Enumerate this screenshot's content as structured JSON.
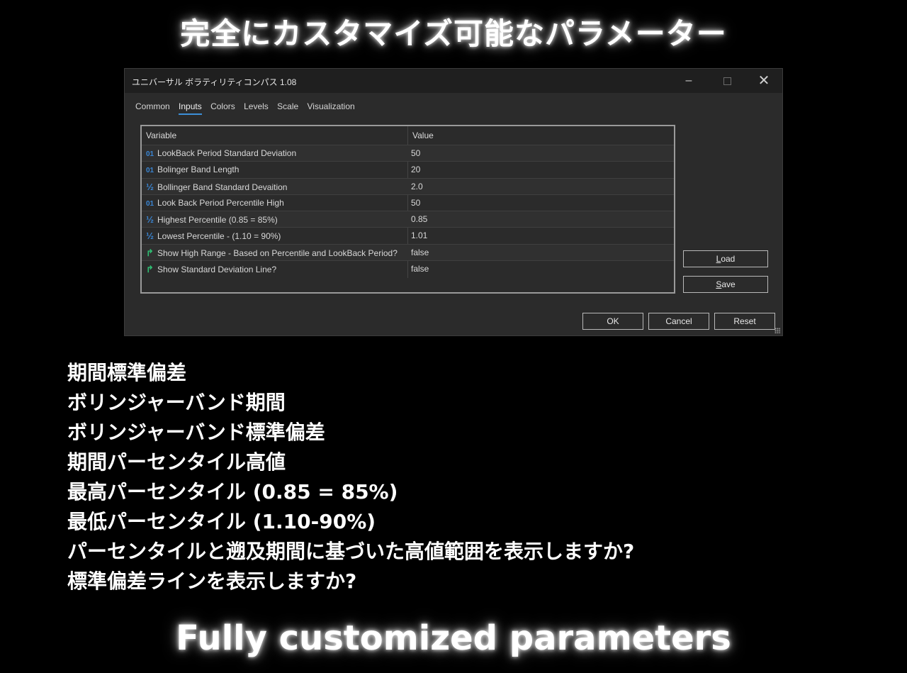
{
  "hero_title": "完全にカスタマイズ可能なパラメーター",
  "footer_title": "Fully customized parameters",
  "window": {
    "title": "ユニバーサル ボラティリティコンパス 1.08",
    "minimize": "–",
    "close": "✕"
  },
  "tabs": [
    {
      "label": "Common"
    },
    {
      "label": "Inputs",
      "active": true
    },
    {
      "label": "Colors"
    },
    {
      "label": "Levels"
    },
    {
      "label": "Scale"
    },
    {
      "label": "Visualization"
    }
  ],
  "grid": {
    "headers": {
      "variable": "Variable",
      "value": "Value"
    },
    "rows": [
      {
        "icon": "integer-icon",
        "glyph": "01",
        "name": "LookBack Period Standard Deviation",
        "value": "50"
      },
      {
        "icon": "integer-icon",
        "glyph": "01",
        "name": "Bolinger Band Length",
        "value": "20"
      },
      {
        "icon": "double-icon",
        "glyph": "½",
        "name": "Bollinger Band Standard Devaition",
        "value": "2.0"
      },
      {
        "icon": "integer-icon",
        "glyph": "01",
        "name": "Look Back Period Percentile High",
        "value": "50"
      },
      {
        "icon": "double-icon",
        "glyph": "½",
        "name": "Highest Percentile (0.85 = 85%)",
        "value": "0.85"
      },
      {
        "icon": "double-icon",
        "glyph": "½",
        "name": "Lowest Percentile - (1.10 = 90%)",
        "value": "1.01"
      },
      {
        "icon": "boolean-icon",
        "glyph": "↱",
        "name": "Show High Range - Based on Percentile and LookBack Period?",
        "value": "false"
      },
      {
        "icon": "boolean-icon",
        "glyph": "↱",
        "name": "Show Standard Deviation Line?",
        "value": "false"
      }
    ]
  },
  "buttons": {
    "load": {
      "mnemonic": "L",
      "rest": "oad"
    },
    "save": {
      "mnemonic": "S",
      "rest": "ave"
    },
    "ok": "OK",
    "cancel": "Cancel",
    "reset": "Reset"
  },
  "japanese_lines": [
    "期間標準偏差",
    "ボリンジャーバンド期間",
    "ボリンジャーバンド標準偏差",
    "期間パーセンタイル高値",
    "最高パーセンタイル (0.85 = 85%)",
    "最低パーセンタイル (1.10-90%)",
    "パーセンタイルと遡及期間に基づいた高値範囲を表示しますか?",
    "標準偏差ラインを表示しますか?"
  ],
  "colors": {
    "background": "#000000",
    "window_bg": "#2b2b2b",
    "titlebar_bg": "#1f1f1f",
    "active_tab_underline": "#3c8fd8",
    "int_icon": "#3a86d4",
    "bool_icon": "#2fbd72"
  }
}
